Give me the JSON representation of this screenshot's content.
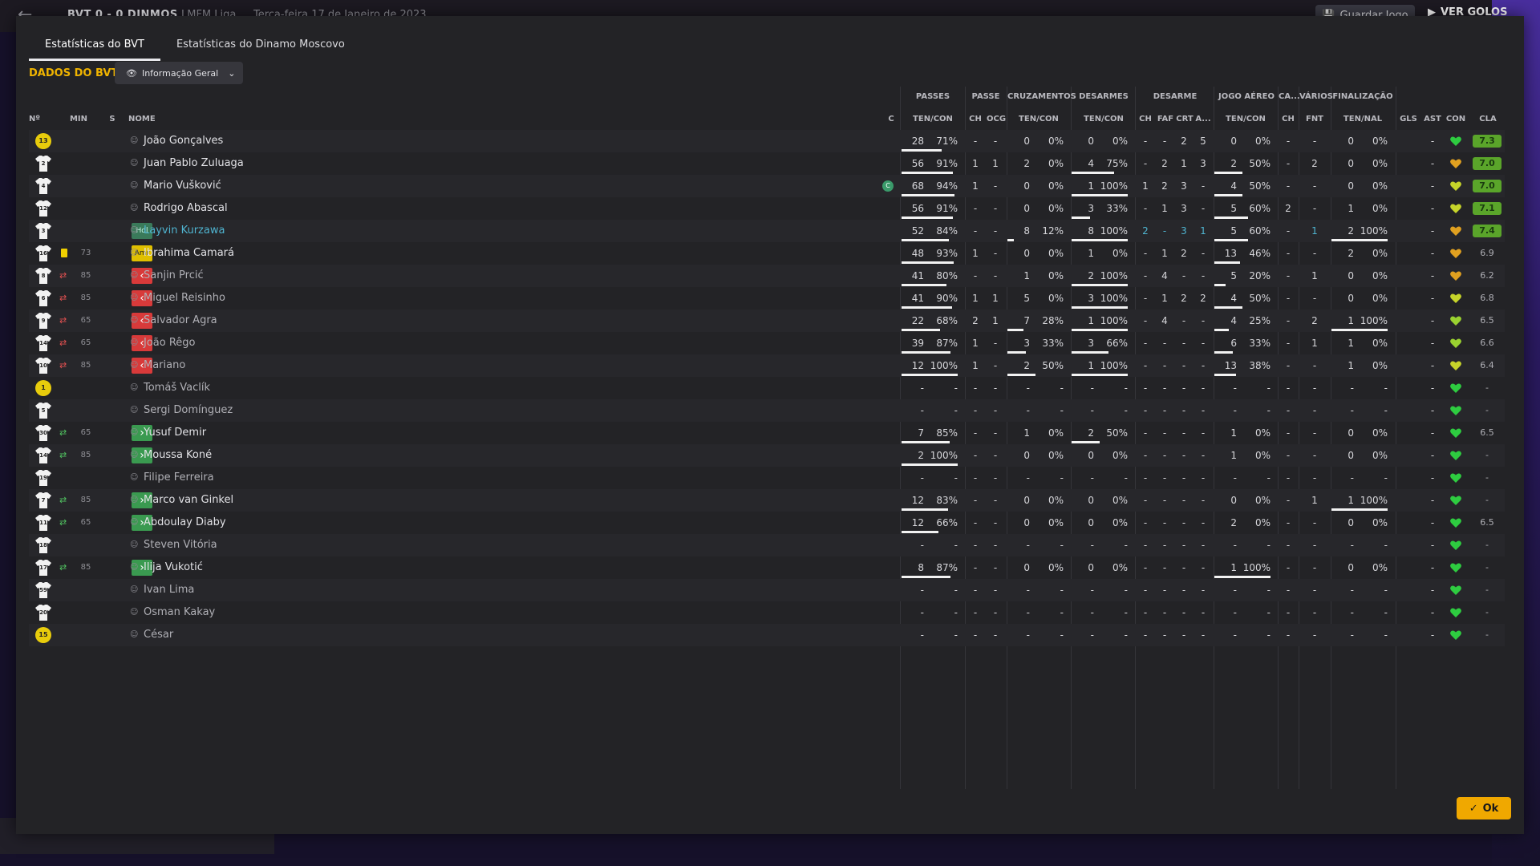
{
  "topbar": {
    "score": "BVT  0 - 0  DINMOS",
    "league": "LMFM Liga",
    "date": "Terça-feira 17 de Janeiro de 2023",
    "save_label": "Guardar Jogo",
    "goals_label": "VER GOLOS"
  },
  "tabs": [
    "Estatísticas do BVT",
    "Estatísticas do Dinamo Moscovo"
  ],
  "section_title": "DADOS DO BVT",
  "view_dropdown": "Informação Geral",
  "group_headers": [
    "PASSES",
    "PASSE",
    "CRUZAMENTOS",
    "DESARMES",
    "DESARME",
    "JOGO AÉREO",
    "CA...",
    "VÁRIOS",
    "FINALIZAÇÃO"
  ],
  "col_headers": {
    "num": "Nº",
    "min": "MIN",
    "s": "S",
    "name": "NOME",
    "c": "C",
    "passes": "TEN/CON",
    "passe_ch": "CH",
    "passe_ocg": "OCG",
    "cruz": "TEN/CON",
    "des": "TEN/CON",
    "d_ch": "CH",
    "d_faf": "FAF",
    "d_crt": "CRT",
    "d_a": "A...",
    "aereo": "TEN/CON",
    "ca_ch": "CH",
    "fnt": "FNT",
    "fin": "TEN/NAL",
    "gls": "GLS",
    "ast": "AST",
    "con": "CON",
    "cla": "CLA"
  },
  "players": [
    {
      "num": "13",
      "gk": true,
      "min": "",
      "s": "",
      "pos": "",
      "name": "João Gonçalves",
      "dim": false,
      "capt": false,
      "p": [
        "28",
        "71%"
      ],
      "pc": [
        "-",
        "-"
      ],
      "cr": [
        "0",
        "0%"
      ],
      "de": [
        "0",
        "0%"
      ],
      "dd": [
        "-",
        "-",
        "2",
        "5"
      ],
      "ae": [
        "0",
        "0%"
      ],
      "ca": "-",
      "fnt": "-",
      "fi": [
        "0",
        "0%"
      ],
      "gls": "",
      "ast": "-",
      "con": "green",
      "cla": "7.3",
      "pbar": 0.71,
      "crbar": 0,
      "debar": 0,
      "aebar": 0,
      "fibar": 0
    },
    {
      "num": "2",
      "gk": false,
      "min": "",
      "s": "",
      "pos": "",
      "name": "Juan Pablo Zuluaga",
      "dim": false,
      "capt": false,
      "p": [
        "56",
        "91%"
      ],
      "pc": [
        "1",
        "1"
      ],
      "cr": [
        "2",
        "0%"
      ],
      "de": [
        "4",
        "75%"
      ],
      "dd": [
        "-",
        "2",
        "1",
        "3"
      ],
      "ae": [
        "2",
        "50%"
      ],
      "ca": "-",
      "fnt": "2",
      "fi": [
        "0",
        "0%"
      ],
      "gls": "",
      "ast": "-",
      "con": "orange",
      "cla": "7.0",
      "pbar": 0.91,
      "crbar": 0,
      "debar": 0.75,
      "aebar": 0.5,
      "fibar": 0
    },
    {
      "num": "4",
      "gk": false,
      "min": "",
      "s": "",
      "pos": "",
      "name": "Mario Vušković",
      "dim": false,
      "capt": true,
      "p": [
        "68",
        "94%"
      ],
      "pc": [
        "1",
        "-"
      ],
      "cr": [
        "0",
        "0%"
      ],
      "de": [
        "1",
        "100%"
      ],
      "dd": [
        "1",
        "2",
        "3",
        "-"
      ],
      "ae": [
        "4",
        "50%"
      ],
      "ca": "-",
      "fnt": "-",
      "fi": [
        "0",
        "0%"
      ],
      "gls": "",
      "ast": "-",
      "con": "yellow",
      "cla": "7.0",
      "pbar": 0.94,
      "crbar": 0,
      "debar": 1,
      "aebar": 0.5,
      "fibar": 0
    },
    {
      "num": "12",
      "gk": false,
      "min": "",
      "s": "",
      "pos": "",
      "name": "Rodrigo Abascal",
      "dim": false,
      "capt": false,
      "p": [
        "56",
        "91%"
      ],
      "pc": [
        "-",
        "-"
      ],
      "cr": [
        "0",
        "0%"
      ],
      "de": [
        "3",
        "33%"
      ],
      "dd": [
        "-",
        "1",
        "3",
        "-"
      ],
      "ae": [
        "5",
        "60%"
      ],
      "ca": "2",
      "fnt": "-",
      "fi": [
        "1",
        "0%"
      ],
      "gls": "",
      "ast": "-",
      "con": "yellow",
      "cla": "7.1",
      "pbar": 0.91,
      "crbar": 0,
      "debar": 0.33,
      "aebar": 0.6,
      "fibar": 0
    },
    {
      "num": "3",
      "gk": false,
      "min": "",
      "s": "",
      "pos": "Hdl",
      "name": "Layvin Kurzawa",
      "dim": false,
      "capt": false,
      "hl": true,
      "p": [
        "52",
        "84%"
      ],
      "pc": [
        "-",
        "-"
      ],
      "cr": [
        "8",
        "12%"
      ],
      "de": [
        "8",
        "100%"
      ],
      "dd": [
        "2",
        "-",
        "3",
        "1"
      ],
      "ae": [
        "5",
        "60%"
      ],
      "ca": "-",
      "fnt": "1",
      "fi": [
        "2",
        "100%"
      ],
      "gls": "",
      "ast": "-",
      "con": "orange",
      "cla": "7.4",
      "pbar": 0.84,
      "crbar": 0.12,
      "debar": 1,
      "aebar": 0.6,
      "fibar": 1
    },
    {
      "num": "16",
      "gk": false,
      "min": "73",
      "s": "card",
      "pos": "Amr",
      "name": "Ibrahima Camará",
      "dim": false,
      "capt": false,
      "p": [
        "48",
        "93%"
      ],
      "pc": [
        "1",
        "-"
      ],
      "cr": [
        "0",
        "0%"
      ],
      "de": [
        "1",
        "0%"
      ],
      "dd": [
        "-",
        "1",
        "2",
        "-"
      ],
      "ae": [
        "13",
        "46%"
      ],
      "ca": "-",
      "fnt": "-",
      "fi": [
        "2",
        "0%"
      ],
      "gls": "",
      "ast": "-",
      "con": "orange",
      "cla": "6.9",
      "pbar": 0.93,
      "crbar": 0,
      "debar": 0,
      "aebar": 0.46,
      "fibar": 0
    },
    {
      "num": "8",
      "gk": false,
      "min": "85",
      "s": "out",
      "pos": "out",
      "name": "Sanjin Prcić",
      "dim": true,
      "capt": false,
      "p": [
        "41",
        "80%"
      ],
      "pc": [
        "-",
        "-"
      ],
      "cr": [
        "1",
        "0%"
      ],
      "de": [
        "2",
        "100%"
      ],
      "dd": [
        "-",
        "4",
        "-",
        "-"
      ],
      "ae": [
        "5",
        "20%"
      ],
      "ca": "-",
      "fnt": "1",
      "fi": [
        "0",
        "0%"
      ],
      "gls": "",
      "ast": "-",
      "con": "orange",
      "cla": "6.2",
      "pbar": 0.8,
      "crbar": 0,
      "debar": 1,
      "aebar": 0.2,
      "fibar": 0
    },
    {
      "num": "6",
      "gk": false,
      "min": "85",
      "s": "out",
      "pos": "out",
      "name": "Miguel Reisinho",
      "dim": true,
      "capt": false,
      "p": [
        "41",
        "90%"
      ],
      "pc": [
        "1",
        "1"
      ],
      "cr": [
        "5",
        "0%"
      ],
      "de": [
        "3",
        "100%"
      ],
      "dd": [
        "-",
        "1",
        "2",
        "2"
      ],
      "ae": [
        "4",
        "50%"
      ],
      "ca": "-",
      "fnt": "-",
      "fi": [
        "0",
        "0%"
      ],
      "gls": "",
      "ast": "-",
      "con": "yellow",
      "cla": "6.8",
      "pbar": 0.9,
      "crbar": 0,
      "debar": 1,
      "aebar": 0.5,
      "fibar": 0
    },
    {
      "num": "9",
      "gk": false,
      "min": "65",
      "s": "out",
      "pos": "out",
      "name": "Salvador Agra",
      "dim": true,
      "capt": false,
      "p": [
        "22",
        "68%"
      ],
      "pc": [
        "2",
        "1"
      ],
      "cr": [
        "7",
        "28%"
      ],
      "de": [
        "1",
        "100%"
      ],
      "dd": [
        "-",
        "4",
        "-",
        "-"
      ],
      "ae": [
        "4",
        "25%"
      ],
      "ca": "-",
      "fnt": "2",
      "fi": [
        "1",
        "100%"
      ],
      "gls": "",
      "ast": "-",
      "con": "lime",
      "cla": "6.5",
      "pbar": 0.68,
      "crbar": 0.28,
      "debar": 1,
      "aebar": 0.25,
      "fibar": 1
    },
    {
      "num": "14",
      "gk": false,
      "min": "65",
      "s": "out",
      "pos": "out",
      "name": "João Rêgo",
      "dim": true,
      "capt": false,
      "p": [
        "39",
        "87%"
      ],
      "pc": [
        "1",
        "-"
      ],
      "cr": [
        "3",
        "33%"
      ],
      "de": [
        "3",
        "66%"
      ],
      "dd": [
        "-",
        "-",
        "-",
        "-"
      ],
      "ae": [
        "6",
        "33%"
      ],
      "ca": "-",
      "fnt": "1",
      "fi": [
        "1",
        "0%"
      ],
      "gls": "",
      "ast": "-",
      "con": "lime",
      "cla": "6.6",
      "pbar": 0.87,
      "crbar": 0.33,
      "debar": 0.66,
      "aebar": 0.33,
      "fibar": 0
    },
    {
      "num": "10",
      "gk": false,
      "min": "85",
      "s": "out",
      "pos": "out",
      "name": "Mariano",
      "dim": true,
      "capt": false,
      "p": [
        "12",
        "100%"
      ],
      "pc": [
        "1",
        "-"
      ],
      "cr": [
        "2",
        "50%"
      ],
      "de": [
        "1",
        "100%"
      ],
      "dd": [
        "-",
        "-",
        "-",
        "-"
      ],
      "ae": [
        "13",
        "38%"
      ],
      "ca": "-",
      "fnt": "-",
      "fi": [
        "1",
        "0%"
      ],
      "gls": "",
      "ast": "-",
      "con": "yellow",
      "cla": "6.4",
      "pbar": 1,
      "crbar": 0.5,
      "debar": 1,
      "aebar": 0.38,
      "fibar": 0
    },
    {
      "num": "1",
      "gk": true,
      "min": "",
      "s": "",
      "pos": "",
      "name": "Tomáš Vaclík",
      "dim": true,
      "capt": false,
      "p": [
        "-",
        "-"
      ],
      "pc": [
        "-",
        "-"
      ],
      "cr": [
        "-",
        "-"
      ],
      "de": [
        "-",
        "-"
      ],
      "dd": [
        "-",
        "-",
        "-",
        "-"
      ],
      "ae": [
        "-",
        "-"
      ],
      "ca": "-",
      "fnt": "-",
      "fi": [
        "-",
        "-"
      ],
      "gls": "",
      "ast": "-",
      "con": "green",
      "cla": "-",
      "pbar": 0,
      "crbar": 0,
      "debar": 0,
      "aebar": 0,
      "fibar": 0
    },
    {
      "num": "5",
      "gk": false,
      "min": "",
      "s": "",
      "pos": "",
      "name": "Sergi Domínguez",
      "dim": true,
      "capt": false,
      "p": [
        "-",
        "-"
      ],
      "pc": [
        "-",
        "-"
      ],
      "cr": [
        "-",
        "-"
      ],
      "de": [
        "-",
        "-"
      ],
      "dd": [
        "-",
        "-",
        "-",
        "-"
      ],
      "ae": [
        "-",
        "-"
      ],
      "ca": "-",
      "fnt": "-",
      "fi": [
        "-",
        "-"
      ],
      "gls": "",
      "ast": "-",
      "con": "green",
      "cla": "-",
      "pbar": 0,
      "crbar": 0,
      "debar": 0,
      "aebar": 0,
      "fibar": 0
    },
    {
      "num": "30",
      "gk": false,
      "min": "65",
      "s": "in",
      "pos": "in",
      "name": "Yusuf Demir",
      "dim": false,
      "capt": false,
      "p": [
        "7",
        "85%"
      ],
      "pc": [
        "-",
        "-"
      ],
      "cr": [
        "1",
        "0%"
      ],
      "de": [
        "2",
        "50%"
      ],
      "dd": [
        "-",
        "-",
        "-",
        "-"
      ],
      "ae": [
        "1",
        "0%"
      ],
      "ca": "-",
      "fnt": "-",
      "fi": [
        "0",
        "0%"
      ],
      "gls": "",
      "ast": "-",
      "con": "green",
      "cla": "6.5",
      "pbar": 0.85,
      "crbar": 0,
      "debar": 0.5,
      "aebar": 0,
      "fibar": 0
    },
    {
      "num": "14",
      "gk": false,
      "min": "85",
      "s": "in",
      "pos": "in",
      "name": "Moussa Koné",
      "dim": false,
      "capt": false,
      "p": [
        "2",
        "100%"
      ],
      "pc": [
        "-",
        "-"
      ],
      "cr": [
        "0",
        "0%"
      ],
      "de": [
        "0",
        "0%"
      ],
      "dd": [
        "-",
        "-",
        "-",
        "-"
      ],
      "ae": [
        "1",
        "0%"
      ],
      "ca": "-",
      "fnt": "-",
      "fi": [
        "0",
        "0%"
      ],
      "gls": "",
      "ast": "-",
      "con": "green",
      "cla": "-",
      "pbar": 1,
      "crbar": 0,
      "debar": 0,
      "aebar": 0,
      "fibar": 0
    },
    {
      "num": "19",
      "gk": false,
      "min": "",
      "s": "",
      "pos": "",
      "name": "Filipe Ferreira",
      "dim": true,
      "capt": false,
      "p": [
        "-",
        "-"
      ],
      "pc": [
        "-",
        "-"
      ],
      "cr": [
        "-",
        "-"
      ],
      "de": [
        "-",
        "-"
      ],
      "dd": [
        "-",
        "-",
        "-",
        "-"
      ],
      "ae": [
        "-",
        "-"
      ],
      "ca": "-",
      "fnt": "-",
      "fi": [
        "-",
        "-"
      ],
      "gls": "",
      "ast": "-",
      "con": "green",
      "cla": "-",
      "pbar": 0,
      "crbar": 0,
      "debar": 0,
      "aebar": 0,
      "fibar": 0
    },
    {
      "num": "7",
      "gk": false,
      "min": "85",
      "s": "in",
      "pos": "in",
      "name": "Marco van Ginkel",
      "dim": false,
      "capt": false,
      "p": [
        "12",
        "83%"
      ],
      "pc": [
        "-",
        "-"
      ],
      "cr": [
        "0",
        "0%"
      ],
      "de": [
        "0",
        "0%"
      ],
      "dd": [
        "-",
        "-",
        "-",
        "-"
      ],
      "ae": [
        "0",
        "0%"
      ],
      "ca": "-",
      "fnt": "1",
      "fi": [
        "1",
        "100%"
      ],
      "gls": "",
      "ast": "-",
      "con": "green",
      "cla": "-",
      "pbar": 0.83,
      "crbar": 0,
      "debar": 0,
      "aebar": 0,
      "fibar": 1
    },
    {
      "num": "11",
      "gk": false,
      "min": "65",
      "s": "in",
      "pos": "in",
      "name": "Abdoulay Diaby",
      "dim": false,
      "capt": false,
      "p": [
        "12",
        "66%"
      ],
      "pc": [
        "-",
        "-"
      ],
      "cr": [
        "0",
        "0%"
      ],
      "de": [
        "0",
        "0%"
      ],
      "dd": [
        "-",
        "-",
        "-",
        "-"
      ],
      "ae": [
        "2",
        "0%"
      ],
      "ca": "-",
      "fnt": "-",
      "fi": [
        "0",
        "0%"
      ],
      "gls": "",
      "ast": "-",
      "con": "green",
      "cla": "6.5",
      "pbar": 0.66,
      "crbar": 0,
      "debar": 0,
      "aebar": 0,
      "fibar": 0
    },
    {
      "num": "18",
      "gk": false,
      "min": "",
      "s": "",
      "pos": "",
      "name": "Steven Vitória",
      "dim": true,
      "capt": false,
      "p": [
        "-",
        "-"
      ],
      "pc": [
        "-",
        "-"
      ],
      "cr": [
        "-",
        "-"
      ],
      "de": [
        "-",
        "-"
      ],
      "dd": [
        "-",
        "-",
        "-",
        "-"
      ],
      "ae": [
        "-",
        "-"
      ],
      "ca": "-",
      "fnt": "-",
      "fi": [
        "-",
        "-"
      ],
      "gls": "",
      "ast": "-",
      "con": "green",
      "cla": "-",
      "pbar": 0,
      "crbar": 0,
      "debar": 0,
      "aebar": 0,
      "fibar": 0
    },
    {
      "num": "17",
      "gk": false,
      "min": "85",
      "s": "in",
      "pos": "in",
      "name": "Ilija Vukotić",
      "dim": false,
      "capt": false,
      "p": [
        "8",
        "87%"
      ],
      "pc": [
        "-",
        "-"
      ],
      "cr": [
        "0",
        "0%"
      ],
      "de": [
        "0",
        "0%"
      ],
      "dd": [
        "-",
        "-",
        "-",
        "-"
      ],
      "ae": [
        "1",
        "100%"
      ],
      "ca": "-",
      "fnt": "-",
      "fi": [
        "0",
        "0%"
      ],
      "gls": "",
      "ast": "-",
      "con": "green",
      "cla": "-",
      "pbar": 0.87,
      "crbar": 0,
      "debar": 0,
      "aebar": 1,
      "fibar": 0
    },
    {
      "num": "59",
      "gk": false,
      "min": "",
      "s": "",
      "pos": "",
      "name": "Ivan Lima",
      "dim": true,
      "capt": false,
      "p": [
        "-",
        "-"
      ],
      "pc": [
        "-",
        "-"
      ],
      "cr": [
        "-",
        "-"
      ],
      "de": [
        "-",
        "-"
      ],
      "dd": [
        "-",
        "-",
        "-",
        "-"
      ],
      "ae": [
        "-",
        "-"
      ],
      "ca": "-",
      "fnt": "-",
      "fi": [
        "-",
        "-"
      ],
      "gls": "",
      "ast": "-",
      "con": "green",
      "cla": "-",
      "pbar": 0,
      "crbar": 0,
      "debar": 0,
      "aebar": 0,
      "fibar": 0
    },
    {
      "num": "20",
      "gk": false,
      "min": "",
      "s": "",
      "pos": "",
      "name": "Osman Kakay",
      "dim": true,
      "capt": false,
      "p": [
        "-",
        "-"
      ],
      "pc": [
        "-",
        "-"
      ],
      "cr": [
        "-",
        "-"
      ],
      "de": [
        "-",
        "-"
      ],
      "dd": [
        "-",
        "-",
        "-",
        "-"
      ],
      "ae": [
        "-",
        "-"
      ],
      "ca": "-",
      "fnt": "-",
      "fi": [
        "-",
        "-"
      ],
      "gls": "",
      "ast": "-",
      "con": "green",
      "cla": "-",
      "pbar": 0,
      "crbar": 0,
      "debar": 0,
      "aebar": 0,
      "fibar": 0
    },
    {
      "num": "15",
      "gk": true,
      "min": "",
      "s": "",
      "pos": "",
      "name": "César",
      "dim": true,
      "capt": false,
      "p": [
        "-",
        "-"
      ],
      "pc": [
        "-",
        "-"
      ],
      "cr": [
        "-",
        "-"
      ],
      "de": [
        "-",
        "-"
      ],
      "dd": [
        "-",
        "-",
        "-",
        "-"
      ],
      "ae": [
        "-",
        "-"
      ],
      "ca": "-",
      "fnt": "-",
      "fi": [
        "-",
        "-"
      ],
      "gls": "",
      "ast": "-",
      "con": "green",
      "cla": "-",
      "pbar": 0,
      "crbar": 0,
      "debar": 0,
      "aebar": 0,
      "fibar": 0
    }
  ],
  "ok_label": "Ok",
  "colors": {
    "accent": "#f0b400",
    "rating_green": "#5aa52a",
    "heart_green": "#2ecc40",
    "heart_yellow": "#c6d42a",
    "heart_orange": "#e0a020",
    "heart_lime": "#9ad230"
  }
}
